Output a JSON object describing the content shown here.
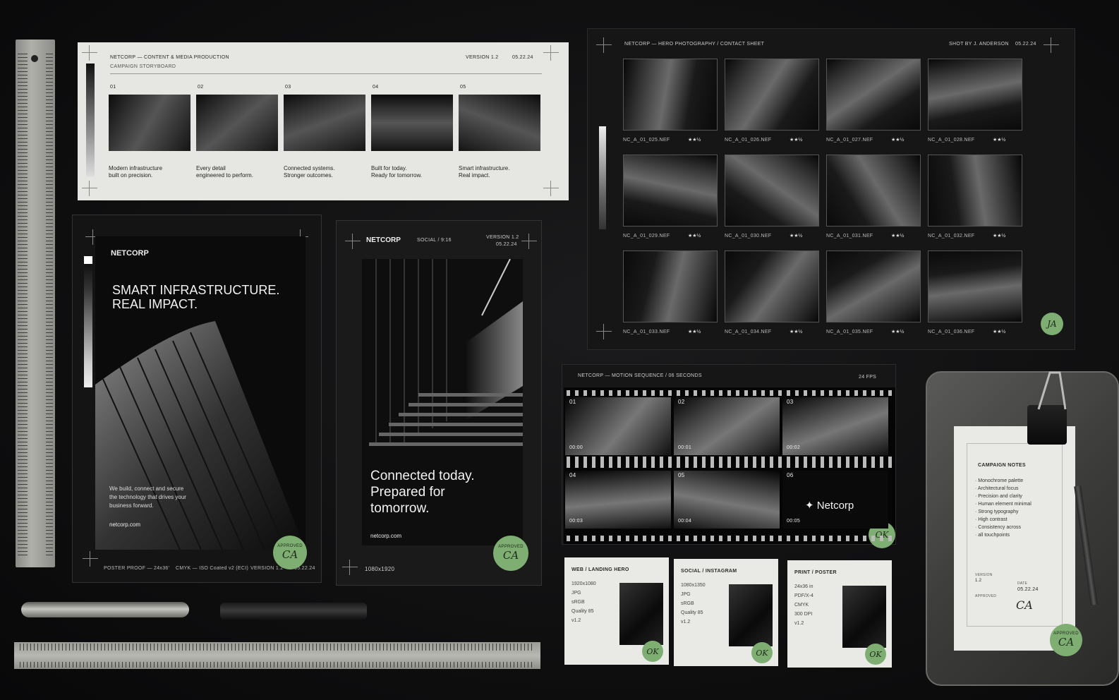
{
  "storyboard": {
    "header_left": "NETCORP — CONTENT & MEDIA PRODUCTION",
    "subheader": "CAMPAIGN STORYBOARD",
    "version": "VERSION 1.2",
    "date": "05.22.24",
    "frames": [
      {
        "num": "01",
        "line1": "Modern infrastructure",
        "line2": "built on precision."
      },
      {
        "num": "02",
        "line1": "Every detail",
        "line2": "engineered to perform."
      },
      {
        "num": "03",
        "line1": "Connected systems.",
        "line2": "Stronger outcomes."
      },
      {
        "num": "04",
        "line1": "Built for today.",
        "line2": "Ready for tomorrow."
      },
      {
        "num": "05",
        "line1": "Smart infrastructure.",
        "line2": "Real impact."
      }
    ]
  },
  "contact_sheet": {
    "header_left": "NETCORP — HERO PHOTOGRAPHY / CONTACT SHEET",
    "shot_by": "SHOT BY J. ANDERSON",
    "date": "05.22.24",
    "initials": "JA",
    "frames": [
      {
        "file": "NC_A_01_025.NEF",
        "rating": "★★½"
      },
      {
        "file": "NC_A_01_026.NEF",
        "rating": "★★½"
      },
      {
        "file": "NC_A_01_027.NEF",
        "rating": "★★½"
      },
      {
        "file": "NC_A_01_028.NEF",
        "rating": "★★½"
      },
      {
        "file": "NC_A_01_029.NEF",
        "rating": "★★½"
      },
      {
        "file": "NC_A_01_030.NEF",
        "rating": "★★½"
      },
      {
        "file": "NC_A_01_031.NEF",
        "rating": "★★½"
      },
      {
        "file": "NC_A_01_032.NEF",
        "rating": "★★½"
      },
      {
        "file": "NC_A_01_033.NEF",
        "rating": "★★½"
      },
      {
        "file": "NC_A_01_034.NEF",
        "rating": "★★½"
      },
      {
        "file": "NC_A_01_035.NEF",
        "rating": "★★½"
      },
      {
        "file": "NC_A_01_036.NEF",
        "rating": "★★½"
      }
    ]
  },
  "poster": {
    "brand": "NETCORP",
    "headline1": "SMART INFRASTRUCTURE.",
    "headline2": "REAL IMPACT.",
    "body1": "We build, connect and secure",
    "body2": "the technology that drives your",
    "body3": "business forward.",
    "url": "netcorp.com",
    "footer_left": "POSTER PROOF — 24x36'",
    "footer_mid": "CMYK — ISO Coated v2 (ECI)",
    "footer_version": "VERSION 1.2",
    "footer_date": "05.22.24",
    "stamp_top": "APPROVED",
    "stamp_sig": "CA"
  },
  "social": {
    "brand": "NETCORP",
    "format": "SOCIAL / 9:16",
    "version": "VERSION 1.2",
    "date": "05.22.24",
    "headline1": "Connected today.",
    "headline2": "Prepared for",
    "headline3": "tomorrow.",
    "url": "netcorp.com",
    "size": "1080x1920",
    "stamp_top": "APPROVED",
    "stamp_sig": "CA"
  },
  "motion": {
    "header": "NETCORP — MOTION SEQUENCE / 06 SECONDS",
    "fps": "24 FPS",
    "logo": "Netcorp",
    "ok": "OK",
    "frames": [
      {
        "num": "01",
        "time": "00:00"
      },
      {
        "num": "02",
        "time": "00:01"
      },
      {
        "num": "03",
        "time": "00:02"
      },
      {
        "num": "04",
        "time": "00:03"
      },
      {
        "num": "05",
        "time": "00:04"
      },
      {
        "num": "06",
        "time": "00:05"
      }
    ]
  },
  "spec_cards": [
    {
      "title": "WEB / LANDING HERO",
      "lines": [
        "1920x1080",
        "JPG",
        "sRGB",
        "Quality 85",
        "v1.2"
      ],
      "ok": "OK"
    },
    {
      "title": "SOCIAL / INSTAGRAM",
      "lines": [
        "1080x1350",
        "JPG",
        "sRGB",
        "Quality 85",
        "v1.2"
      ],
      "ok": "OK"
    },
    {
      "title": "PRINT / POSTER",
      "lines": [
        "24x36 in",
        "PDF/X-4",
        "CMYK",
        "300 DPI",
        "v1.2"
      ],
      "ok": "OK"
    }
  ],
  "notes": {
    "title": "CAMPAIGN NOTES",
    "items": [
      "Monochrome palette",
      "Architectural focus",
      "Precision and clarity",
      "Human element minimal",
      "Strong typography",
      "High contrast",
      "Consistency across",
      "all touchpoints"
    ],
    "version_label": "VERSION",
    "version_value": "1.2",
    "date_label": "DATE",
    "date_value": "05.22.24",
    "approved_label": "APPROVED",
    "signature": "CA",
    "stamp_top": "APPROVED",
    "stamp_sig": "CA"
  },
  "colors": {
    "stamp_green": "#7fae72",
    "desk": "#0f0f10",
    "paper": "#e9e9e6"
  }
}
